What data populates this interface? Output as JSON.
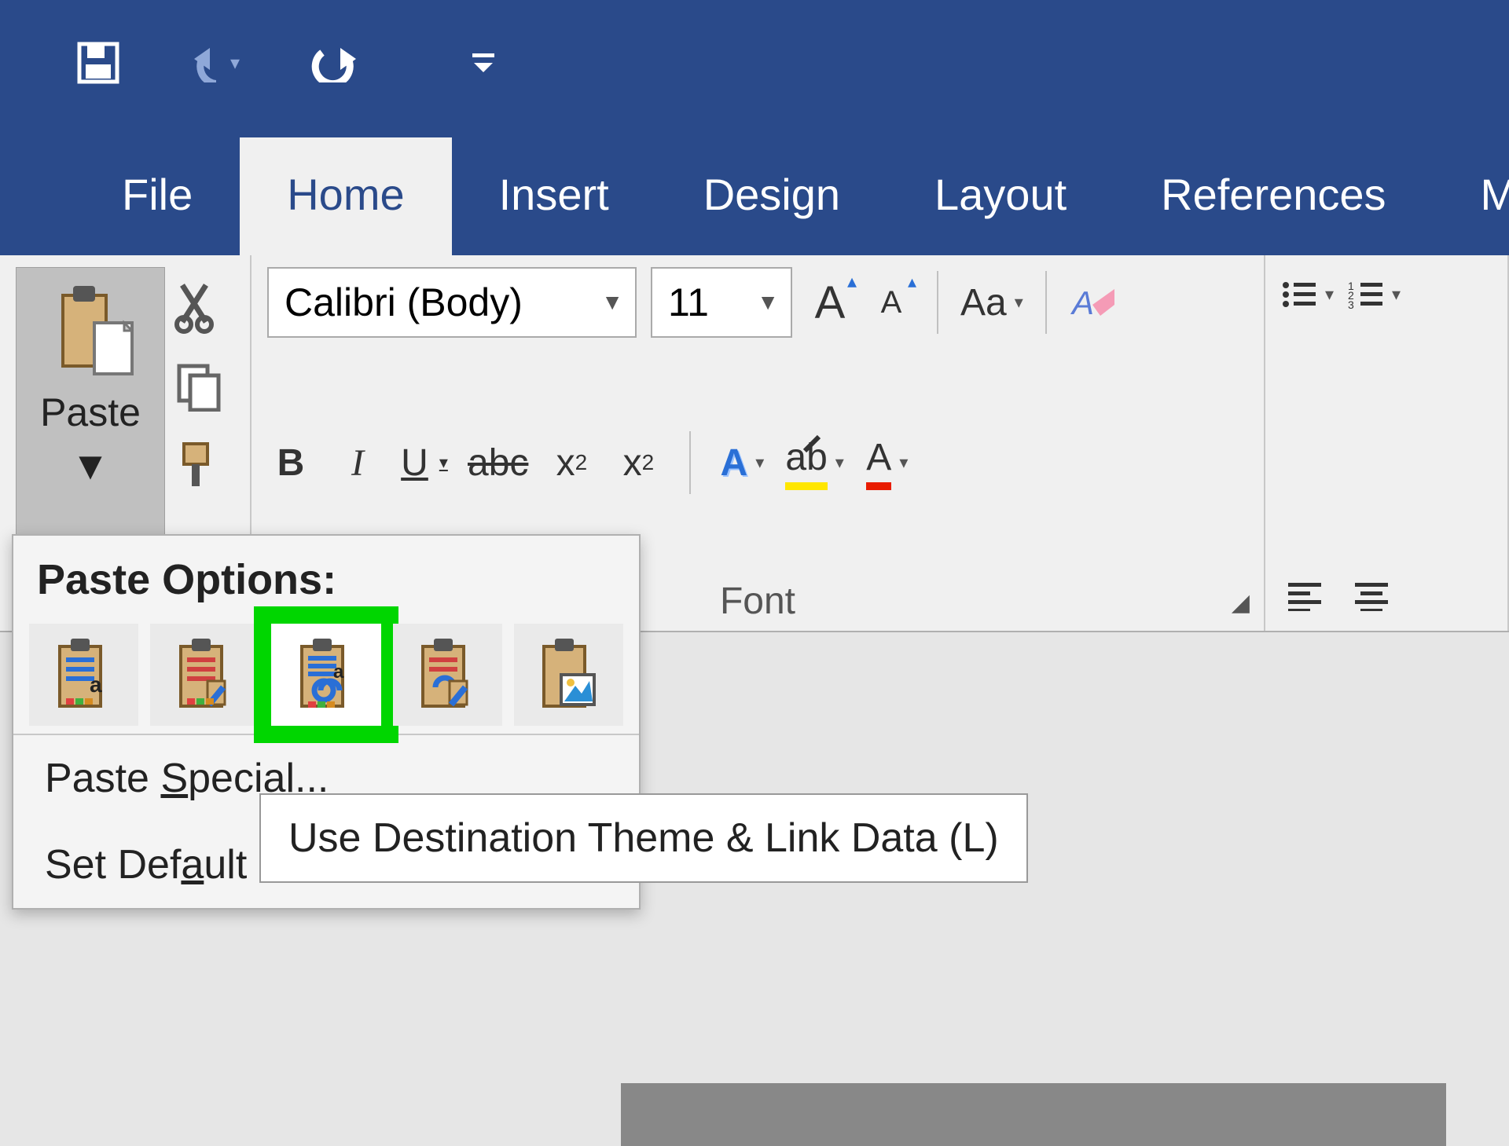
{
  "tabs": {
    "file": "File",
    "home": "Home",
    "insert": "Insert",
    "design": "Design",
    "layout": "Layout",
    "references": "References",
    "next_partial": "M"
  },
  "clipboard": {
    "paste": "Paste"
  },
  "font": {
    "name": "Calibri (Body)",
    "size": "11",
    "groupLabel": "Font",
    "bold": "B",
    "italic": "I",
    "underline": "U",
    "strike": "abc",
    "subscript": "x",
    "sub2": "2",
    "superscript": "x",
    "sup2": "2",
    "growA": "A",
    "shrinkA": "A",
    "caseAa": "Aa",
    "effectsA": "A",
    "highlight": "ab",
    "colorA": "A"
  },
  "pasteMenu": {
    "title": "Paste Options:",
    "special": "Paste",
    "setDefault": "Set Default Paste...",
    "tooltip": "Use Destination Theme & Link Data (L)"
  }
}
